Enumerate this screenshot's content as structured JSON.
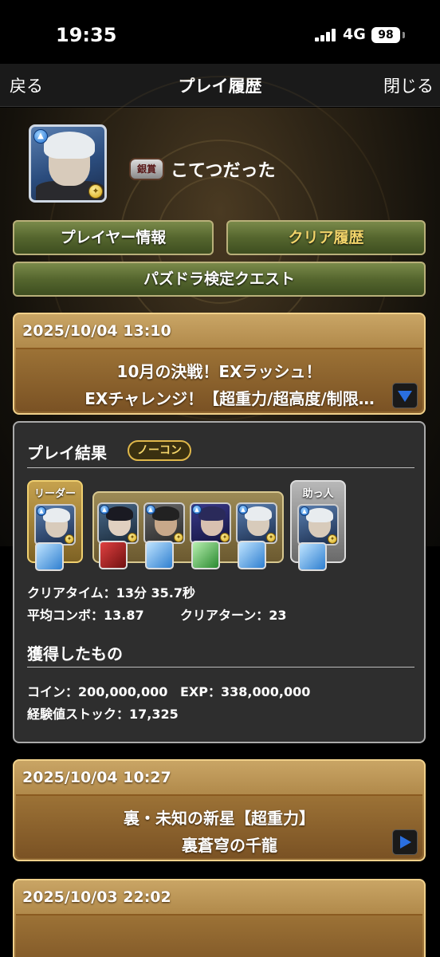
{
  "status_bar": {
    "time": "19:35",
    "network": "4G",
    "battery": "98"
  },
  "nav": {
    "back_label": "戻る",
    "title": "プレイ履歴",
    "close_label": "閉じる"
  },
  "profile": {
    "rank_badge": "銀賞",
    "player_name": "こてつだった"
  },
  "buttons": {
    "player_info": "プレイヤー情報",
    "clear_history": "クリア履歴",
    "puzzdra_quest": "パズドラ検定クエスト"
  },
  "history": [
    {
      "date": "2025/10/04 13:10",
      "dungeon": "10月の決戦！EXラッシュ！",
      "floor": "EXチャレンジ！【超重力/超高度/制限…",
      "expanded": true
    },
    {
      "date": "2025/10/04 10:27",
      "dungeon": "裏・未知の新星【超重力】",
      "floor": "裏蒼穹の千龍",
      "expanded": false
    },
    {
      "date": "2025/10/03 22:02",
      "dungeon": "",
      "floor": "",
      "expanded": false
    }
  ],
  "result": {
    "heading": "プレイ結果",
    "badge": "ノーコン",
    "team_labels": {
      "leader": "リーダー",
      "helper": "助っ人"
    },
    "clear_time": "クリアタイム：13分 35.7秒",
    "avg_combo": "平均コンボ：13.87",
    "clear_turn": "クリアターン：23",
    "rewards_heading": "獲得したもの",
    "coins": "コイン：200,000,000",
    "exp": "EXP：338,000,000",
    "exp_stock": "経験値ストック：17,325"
  },
  "colors": {
    "gold_card": "#a57c3e",
    "green_button": "#55662e",
    "active_tab_text": "#f2d46a",
    "panel_bg": "#2e2e2e",
    "arrow_blue": "#2a6fe0"
  }
}
